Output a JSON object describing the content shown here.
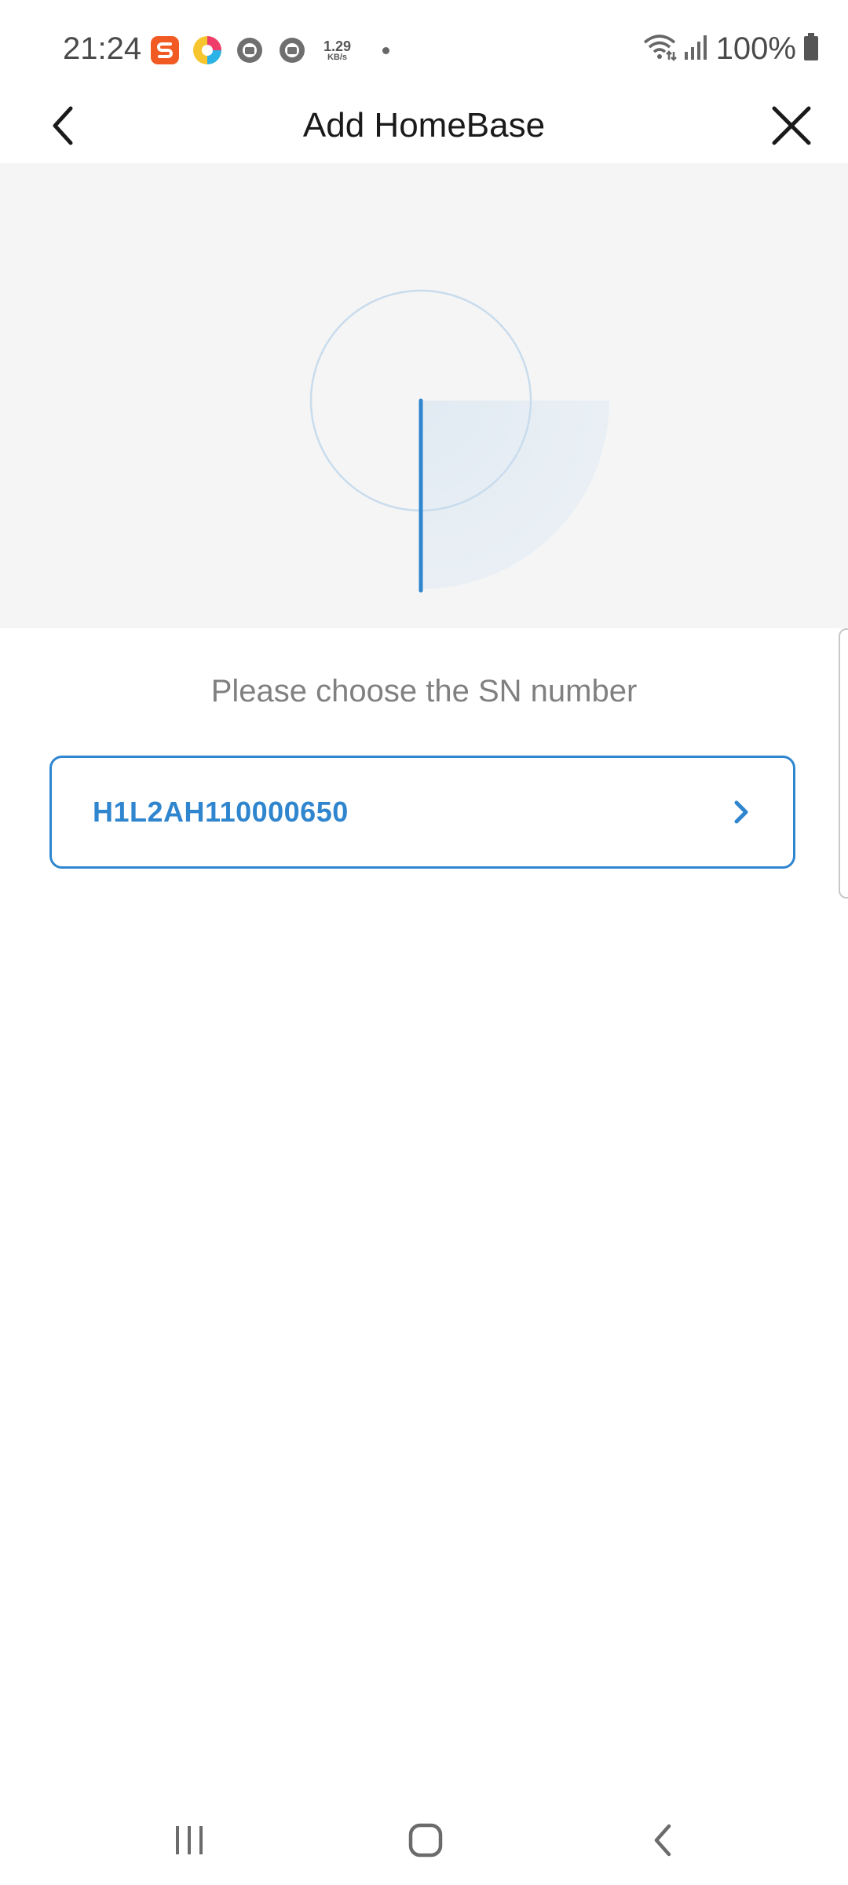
{
  "status_bar": {
    "time": "21:24",
    "net_speed_value": "1.29",
    "net_speed_unit": "KB/s",
    "battery": "100%",
    "icons": [
      "sogou-s-icon",
      "colorful-app-icon",
      "grey-app-icon",
      "grey-app-icon-2",
      "wifi-icon",
      "signal-icon",
      "battery-icon"
    ]
  },
  "header": {
    "title": "Add HomeBase",
    "back_icon": "chevron-left-icon",
    "close_icon": "close-icon"
  },
  "main": {
    "prompt": "Please choose the SN number",
    "sn_options": [
      {
        "value": "H1L2AH110000650"
      }
    ],
    "chevron_icon": "chevron-right-icon"
  },
  "nav_bar": {
    "icons": [
      "recent-apps-icon",
      "home-icon",
      "back-icon"
    ]
  },
  "colors": {
    "accent": "#2f86cf",
    "radar_bg": "#f5f5f5",
    "prompt_text": "#808080",
    "title_text": "#1a1a1a"
  }
}
